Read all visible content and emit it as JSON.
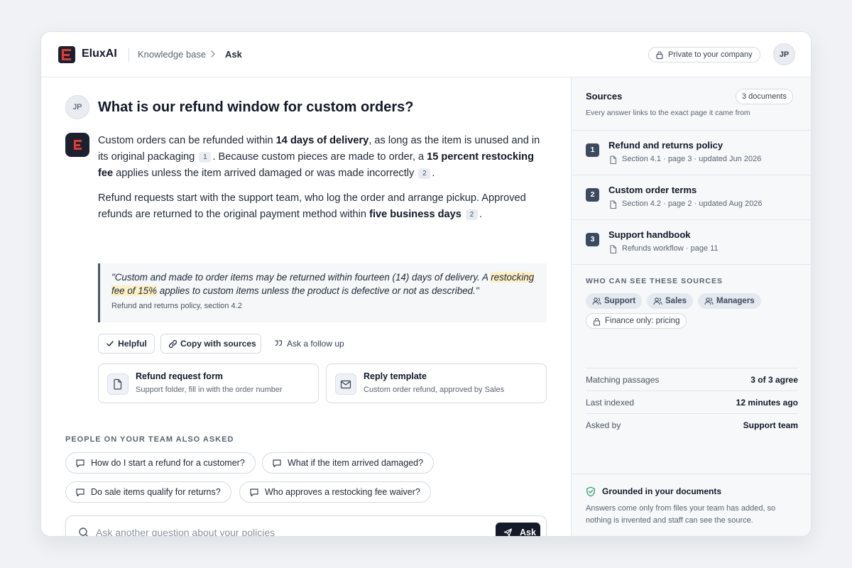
{
  "header": {
    "brand": "EluxAI",
    "breadcrumb": {
      "parent": "Knowledge base",
      "current": "Ask"
    },
    "privacy_label": "Private to your company",
    "user_initials": "JP"
  },
  "conversation": {
    "user_initials": "JP",
    "question": "What is our refund window for custom orders?",
    "answer": {
      "p1": {
        "t1": "Custom orders can be refunded within ",
        "b1": "14 days of delivery",
        "t2": ", as long as the item is unused and in its original packaging",
        "c1": "1",
        "t3": ". Because custom pieces are made to order, a ",
        "b2": "15 percent restocking fee",
        "t4": " applies unless the item arrived damaged or was made incorrectly",
        "c2": "2",
        "t5": "."
      },
      "p2": {
        "t1": "Refund requests start with the support team, who log the order and arrange pickup. Approved refunds are returned to the original payment method within ",
        "b1": "five business days",
        "c1": "2",
        "t2": "."
      }
    },
    "quote": {
      "before": "\"Custom and made to order items may be returned within fourteen (14) days of delivery. A ",
      "highlight": "restocking fee of 15%",
      "after": " applies to custom items unless the product is defective or not as described.\"",
      "source": "Refund and returns policy, section 4.2"
    },
    "actions": {
      "helpful": "Helpful",
      "copy": "Copy with sources",
      "follow_up": "Ask a follow up"
    },
    "attachments": [
      {
        "title": "Refund request form",
        "subtitle": "Support folder, fill in with the order number",
        "icon": "document-icon"
      },
      {
        "title": "Reply template",
        "subtitle": "Custom order refund, approved by Sales",
        "icon": "mail-icon"
      }
    ]
  },
  "also_asked": {
    "heading": "PEOPLE ON YOUR TEAM ALSO ASKED",
    "questions": [
      "How do I start a refund for a customer?",
      "What if the item arrived damaged?",
      "Do sale items qualify for returns?",
      "Who approves a restocking fee waiver?"
    ]
  },
  "ask": {
    "placeholder": "Ask another question about your policies",
    "value": "",
    "button": "Ask"
  },
  "sidebar": {
    "sources_heading": "Sources",
    "sources_count": "3 documents",
    "sources_subtitle": "Every answer links to the exact page it came from",
    "sources": [
      {
        "num": "1",
        "title": "Refund and returns policy",
        "meta": "Section 4.1 · page 3 · updated Jun 2026"
      },
      {
        "num": "2",
        "title": "Custom order terms",
        "meta": "Section 4.2 · page 2 · updated Aug 2026"
      },
      {
        "num": "3",
        "title": "Support handbook",
        "meta": "Refunds workflow · page 11"
      }
    ],
    "visibility": {
      "heading": "WHO CAN SEE THESE SOURCES",
      "roles": [
        "Support",
        "Sales",
        "Managers"
      ],
      "restricted": "Finance only: pricing"
    },
    "stats": [
      {
        "label": "Matching passages",
        "value": "3 of 3 agree"
      },
      {
        "label": "Last indexed",
        "value": "12 minutes ago"
      },
      {
        "label": "Asked by",
        "value": "Support team"
      }
    ],
    "grounded": {
      "title": "Grounded in your documents",
      "text": "Answers come only from files your team has added, so nothing is invented and staff can see the source."
    }
  },
  "colors": {
    "brand_red": "#e13b2f",
    "dark": "#141a28",
    "source_badge": "#3c4a60",
    "highlight": "#fdf0c4",
    "grounded_green": "#2f9e6b"
  }
}
